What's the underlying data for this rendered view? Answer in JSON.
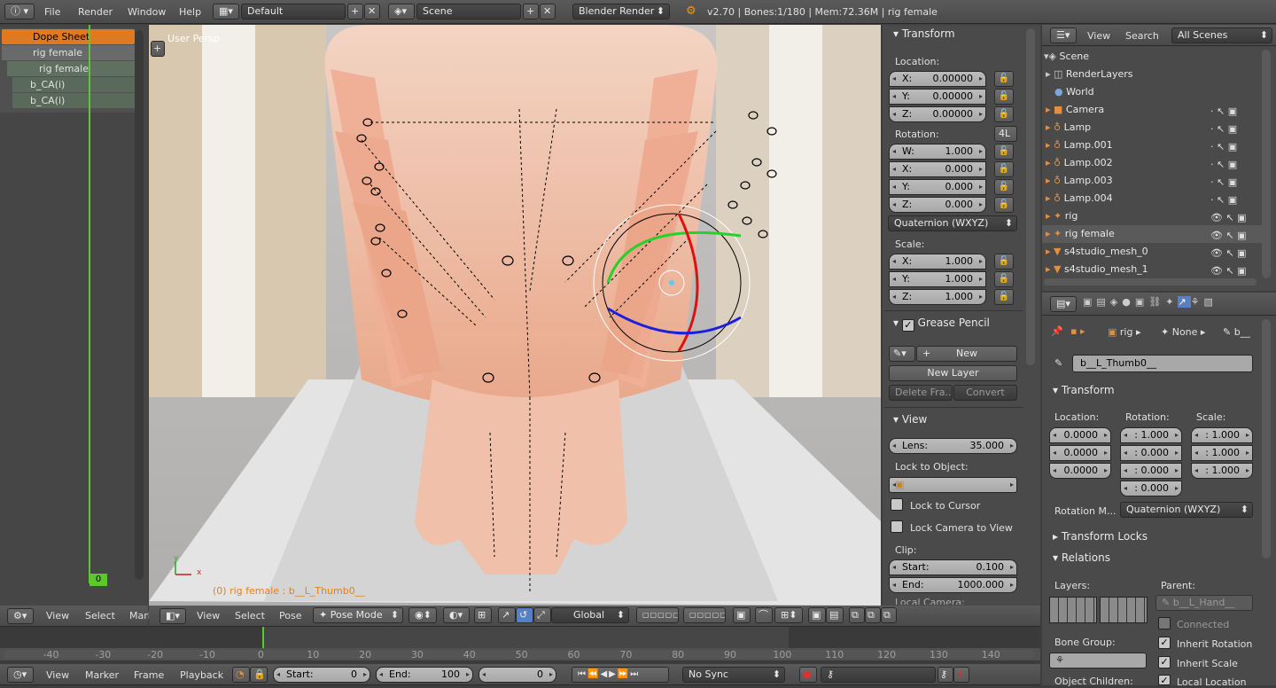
{
  "topbar": {
    "menus": [
      "File",
      "Render",
      "Window",
      "Help"
    ],
    "layout": "Default",
    "scene": "Scene",
    "engine": "Blender Render",
    "stats": "v2.70 | Bones:1/180 | Mem:72.36M | rig female"
  },
  "dopesheet": {
    "rows": [
      "Dope Sheet",
      "rig female",
      "rig female",
      "b_CA(i)",
      "b_CA(i)"
    ],
    "frame": "0",
    "menus": [
      "View",
      "Select",
      "Mark"
    ]
  },
  "viewport": {
    "label": "User Persp",
    "status": "(0) rig female : b__L_Thumb0__",
    "menus": [
      "View",
      "Select",
      "Pose"
    ],
    "mode": "Pose Mode",
    "orientation": "Global"
  },
  "npanel": {
    "transform_title": "Transform",
    "location_label": "Location:",
    "location": [
      {
        "a": "X:",
        "v": "0.00000"
      },
      {
        "a": "Y:",
        "v": "0.00000"
      },
      {
        "a": "Z:",
        "v": "0.00000"
      }
    ],
    "rotation_label": "Rotation:",
    "rot_tag": "4L",
    "rotation": [
      {
        "a": "W:",
        "v": "1.000"
      },
      {
        "a": "X:",
        "v": "0.000"
      },
      {
        "a": "Y:",
        "v": "0.000"
      },
      {
        "a": "Z:",
        "v": "0.000"
      }
    ],
    "rot_mode": "Quaternion (WXYZ)",
    "scale_label": "Scale:",
    "scale": [
      {
        "a": "X:",
        "v": "1.000"
      },
      {
        "a": "Y:",
        "v": "1.000"
      },
      {
        "a": "Z:",
        "v": "1.000"
      }
    ],
    "grease_title": "Grease Pencil",
    "new_btn": "New",
    "new_layer": "New Layer",
    "delete_frame": "Delete Fra...",
    "convert": "Convert",
    "view_title": "View",
    "lens_label": "Lens:",
    "lens_value": "35.000",
    "lock_object": "Lock to Object:",
    "lock_cursor": "Lock to Cursor",
    "lock_camera": "Lock Camera to View",
    "clip_label": "Clip:",
    "clip_start_label": "Start:",
    "clip_start": "0.100",
    "clip_end_label": "End:",
    "clip_end": "1000.000",
    "local_camera": "Local Camera:"
  },
  "outliner": {
    "menus": [
      "View",
      "Search"
    ],
    "filter": "All Scenes",
    "items": [
      "Scene",
      "RenderLayers",
      "World",
      "Camera",
      "Lamp",
      "Lamp.001",
      "Lamp.002",
      "Lamp.003",
      "Lamp.004",
      "rig",
      "rig female",
      "s4studio_mesh_0",
      "s4studio_mesh_1"
    ]
  },
  "properties": {
    "breadcrumb": [
      "rig",
      "None",
      "b__"
    ],
    "bone_name": "b__L_Thumb0__",
    "transform_title": "Transform",
    "loc_label": "Location:",
    "rot_label": "Rotation:",
    "scale_label": "Scale:",
    "loc": [
      "0.0000",
      "0.0000",
      "0.0000"
    ],
    "rot": [
      ": 1.000",
      ": 0.000",
      ": 0.000",
      ": 0.000"
    ],
    "scale": [
      ": 1.000",
      ": 1.000",
      ": 1.000"
    ],
    "rot_mode_label": "Rotation M...",
    "rot_mode": "Quaternion (WXYZ)",
    "transform_locks": "Transform Locks",
    "relations": "Relations",
    "layers": "Layers:",
    "parent": "Parent:",
    "parent_value": "b__L_Hand__",
    "connected": "Connected",
    "bone_group": "Bone Group:",
    "inherit_rotation": "Inherit Rotation",
    "inherit_scale": "Inherit Scale",
    "object_children": "Object Children:",
    "local_location": "Local Location"
  },
  "timeline": {
    "ticks": [
      "-40",
      "-30",
      "-20",
      "-10",
      "0",
      "10",
      "20",
      "30",
      "40",
      "50",
      "60",
      "70",
      "80",
      "90",
      "100",
      "110",
      "120",
      "130",
      "140"
    ],
    "menus": [
      "View",
      "Marker",
      "Frame",
      "Playback"
    ],
    "start_label": "Start:",
    "start": "0",
    "end_label": "End:",
    "end": "100",
    "current": "0",
    "sync": "No Sync"
  }
}
